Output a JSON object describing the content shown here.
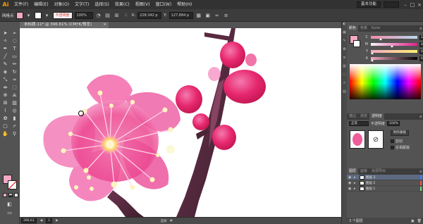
{
  "app": {
    "logo": "Ai"
  },
  "menubar": {
    "items": [
      "文件(F)",
      "编辑(E)",
      "对象(O)",
      "文字(T)",
      "选择(S)",
      "效果(C)",
      "视图(V)",
      "窗口(W)",
      "帮助(H)"
    ],
    "workspace": "基本功能",
    "window_buttons": [
      "–",
      "□",
      "×"
    ]
  },
  "controlbar": {
    "label": "网格点",
    "blend_mode": "不透明度",
    "opacity": "100%",
    "x": "228.342 p",
    "y": "127.884 p",
    "fill_color": "#f4a8c4",
    "stroke_color": "#ffffff"
  },
  "document": {
    "tab_title": "未标题-11* @ 396.61% (CMYK/预览)",
    "close": "×"
  },
  "statusbar": {
    "zoom": "396.61",
    "page": "1",
    "tool": "选择"
  },
  "color_panel": {
    "tabs": [
      "颜色",
      "色板",
      "Kuler"
    ],
    "channels": [
      {
        "label": "C",
        "value": "18.82",
        "position": 0.19,
        "gradient": [
          "#f28ca8",
          "#b8d8f0"
        ]
      },
      {
        "label": "M",
        "value": "42.75",
        "position": 0.43,
        "gradient": [
          "#f4f4f4",
          "#e0208a"
        ]
      },
      {
        "label": "Y",
        "value": "0",
        "position": 0.0,
        "gradient": [
          "#f4a8c4",
          "#fff070"
        ]
      },
      {
        "label": "K",
        "value": "0",
        "position": 0.0,
        "gradient": [
          "#f4a8c4",
          "#000000"
        ]
      }
    ]
  },
  "transparency_panel": {
    "tabs": [
      "描边",
      "渐变",
      "透明度"
    ],
    "mode": "正常",
    "opacity_label": "不透明度",
    "opacity": "100%",
    "make_mask": "制作蒙版",
    "clip": "剪切",
    "invert_mask": "反相蒙版"
  },
  "layers_panel": {
    "tabs": [
      "图层",
      "画板",
      "资源导出"
    ],
    "layers": [
      {
        "name": "图层 3",
        "color": "#4c79ff"
      },
      {
        "name": "图层 2",
        "color": "#ff4f4f"
      },
      {
        "name": "图层 1",
        "color": "#7fd87f"
      }
    ],
    "footer": "3 个图层"
  },
  "toolbox": {
    "tools": [
      "selection-icon",
      "direct-select-icon",
      "magic-wand-icon",
      "lasso-icon",
      "pen-icon",
      "type-icon",
      "line-icon",
      "rectangle-icon",
      "brush-icon",
      "pencil-icon",
      "eraser-icon",
      "rotate-icon",
      "scale-icon",
      "warp-icon",
      "width-icon",
      "free-transform-icon",
      "shape-builder-icon",
      "perspective-icon",
      "mesh-icon",
      "gradient-icon",
      "eyedropper-icon",
      "blend-icon",
      "symbol-icon",
      "graph-icon",
      "artboard-icon",
      "slice-icon",
      "hand-icon",
      "zoom-icon"
    ]
  }
}
